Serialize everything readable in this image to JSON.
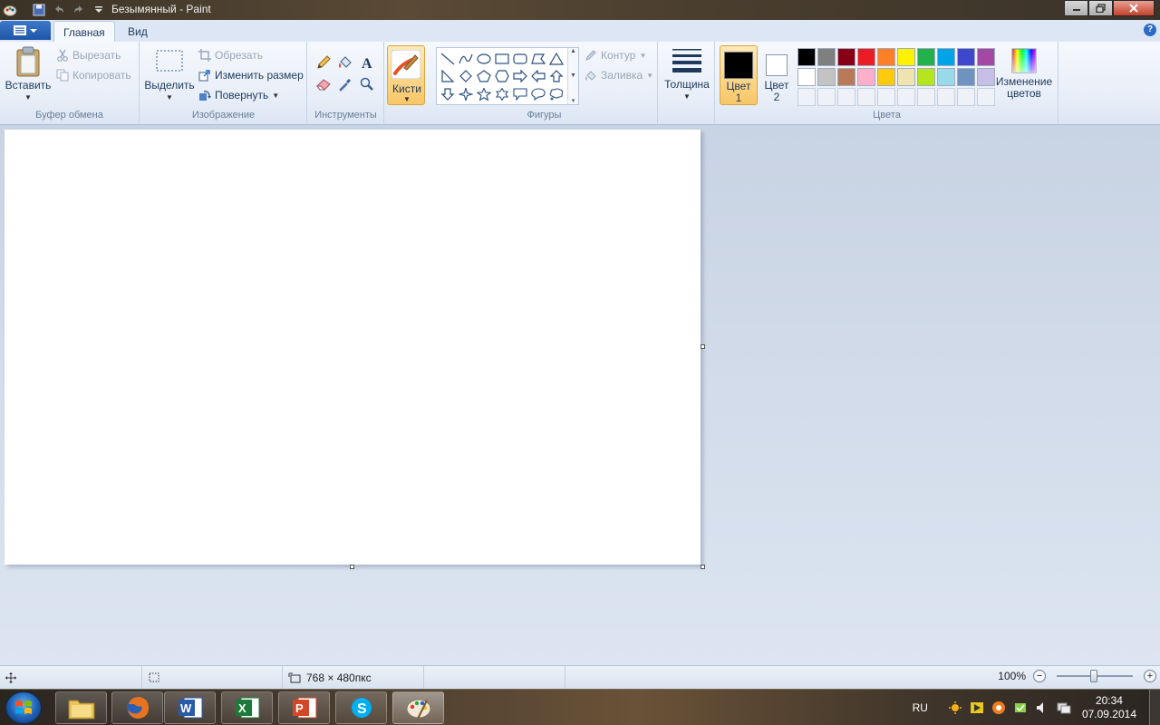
{
  "window": {
    "title": "Безымянный - Paint"
  },
  "tabs": {
    "home": "Главная",
    "view": "Вид"
  },
  "clipboard": {
    "paste": "Вставить",
    "cut": "Вырезать",
    "copy": "Копировать",
    "group": "Буфер обмена"
  },
  "image": {
    "select": "Выделить",
    "crop": "Обрезать",
    "resize": "Изменить размер",
    "rotate": "Повернуть",
    "group": "Изображение"
  },
  "tools": {
    "group": "Инструменты"
  },
  "brushes": {
    "label": "Кисти"
  },
  "shapes": {
    "outline": "Контур",
    "fill": "Заливка",
    "group": "Фигуры"
  },
  "size": {
    "label": "Толщина"
  },
  "colors": {
    "color1_line1": "Цвет",
    "color1_line2": "1",
    "color2_line1": "Цвет",
    "color2_line2": "2",
    "edit_line1": "Изменение",
    "edit_line2": "цветов",
    "group": "Цвета",
    "color1_value": "#000000",
    "color2_value": "#ffffff",
    "palette_row1": [
      "#000000",
      "#7f7f7f",
      "#880015",
      "#ed1c24",
      "#ff7f27",
      "#fff200",
      "#22b14c",
      "#00a2e8",
      "#3f48cc",
      "#a349a4"
    ],
    "palette_row2": [
      "#ffffff",
      "#c3c3c3",
      "#b97a57",
      "#ffaec9",
      "#ffc90e",
      "#efe4b0",
      "#b5e61d",
      "#99d9ea",
      "#7092be",
      "#c8bfe7"
    ]
  },
  "statusbar": {
    "image_size": "768 × 480пкс",
    "zoom": "100%",
    "zoom_minus": "−",
    "zoom_plus": "+",
    "zoom_slider_fraction": 0.5
  },
  "taskbar": {
    "lang": "RU",
    "time": "20:34",
    "date": "07.09.2014"
  }
}
